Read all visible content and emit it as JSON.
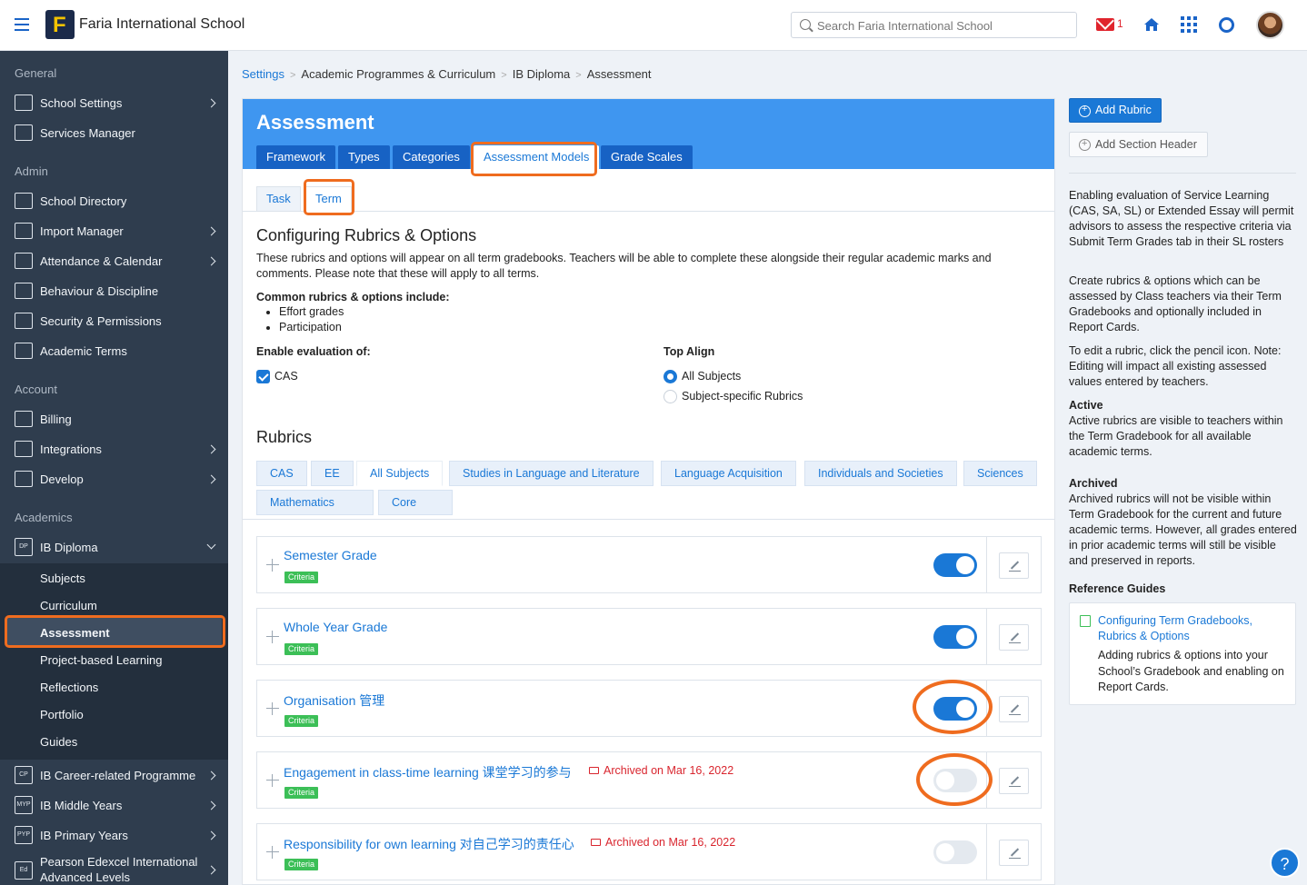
{
  "header": {
    "school_name": "Faria International School",
    "search_placeholder": "Search Faria International School",
    "mail_count": "1"
  },
  "sidebar": {
    "sections": {
      "general": "General",
      "admin": "Admin",
      "account": "Account",
      "academics": "Academics"
    },
    "items": {
      "school_settings": "School Settings",
      "services_manager": "Services Manager",
      "school_directory": "School Directory",
      "import_manager": "Import Manager",
      "attendance": "Attendance & Calendar",
      "behaviour": "Behaviour & Discipline",
      "security": "Security & Permissions",
      "academic_terms": "Academic Terms",
      "billing": "Billing",
      "integrations": "Integrations",
      "develop": "Develop",
      "ib_diploma": "IB Diploma",
      "ib_career": "IB Career-related Programme",
      "ib_middle": "IB Middle Years",
      "ib_primary": "IB Primary Years",
      "pearson_1": "Pearson Edexcel International",
      "pearson_2": "Advanced Levels"
    },
    "icon_texts": {
      "dp": "DP",
      "cp": "CP",
      "myp": "MYP",
      "pyp": "PYP",
      "ed": "Ed"
    },
    "sub_items": [
      "Subjects",
      "Curriculum",
      "Assessment",
      "Project-based Learning",
      "Reflections",
      "Portfolio",
      "Guides"
    ]
  },
  "breadcrumb": [
    "Settings",
    "Academic Programmes & Curriculum",
    "IB Diploma",
    "Assessment"
  ],
  "main": {
    "title": "Assessment",
    "tabs": [
      "Framework",
      "Types",
      "Categories",
      "Assessment Models",
      "Grade Scales"
    ],
    "subtabs": [
      "Task",
      "Term"
    ],
    "config_title": "Configuring Rubrics & Options",
    "config_desc": "These rubrics and options will appear on all term gradebooks. Teachers will be able to complete these alongside their regular academic marks and comments. Please note that these will apply to all terms.",
    "common_label": "Common rubrics & options include:",
    "common_items": [
      "Effort grades",
      "Participation"
    ],
    "enable_label": "Enable evaluation of:",
    "enable_cas": "CAS",
    "top_align_label": "Top Align",
    "top_align_options": [
      "All Subjects",
      "Subject-specific Rubrics"
    ],
    "rubrics_title": "Rubrics",
    "filters": [
      "CAS",
      "EE",
      "All Subjects",
      "Studies in Language and Literature",
      "Language Acquisition",
      "Individuals and Societies",
      "Sciences",
      "Mathematics",
      "Core"
    ],
    "rubrics": [
      {
        "title": "Semester Grade",
        "badge": "Criteria",
        "archived": "",
        "active": true
      },
      {
        "title": "Whole Year Grade",
        "badge": "Criteria",
        "archived": "",
        "active": true
      },
      {
        "title": "Organisation 管理",
        "badge": "Criteria",
        "archived": "",
        "active": true
      },
      {
        "title": "Engagement in class-time learning 课堂学习的参与",
        "badge": "Criteria",
        "archived": "Archived on Mar 16, 2022",
        "active": false
      },
      {
        "title": "Responsibility for own learning 对自己学习的责任心",
        "badge": "Criteria",
        "archived": "Archived on Mar 16, 2022",
        "active": false
      }
    ]
  },
  "right": {
    "add_rubric": "Add Rubric",
    "add_section_header": "Add Section Header",
    "p1": "Enabling evaluation of Service Learning (CAS, SA, SL) or Extended Essay will permit advisors to assess the respective criteria via Submit Term Grades tab in their SL rosters",
    "p2": "Create rubrics & options which can be assessed by Class teachers via their Term Gradebooks and optionally included in Report Cards.",
    "p3": "To edit a rubric, click the pencil icon. Note: Editing will impact all existing assessed values entered by teachers.",
    "active_head": "Active",
    "active_text": "Active rubrics are visible to teachers within the Term Gradebook for all available academic terms.",
    "archived_head": "Archived",
    "archived_text": "Archived rubrics will not be visible within Term Gradebook for the current and future academic terms. However, all grades entered in prior academic terms will still be visible and preserved in reports.",
    "ref_head": "Reference Guides",
    "guide_link": "Configuring Term Gradebooks, Rubrics & Options",
    "guide_desc": "Adding rubrics & options into your School’s Gradebook and enabling on Report Cards."
  },
  "help_fab": "?",
  "colors": {
    "brand_blue": "#1a78d6",
    "header_band": "#3f96f0",
    "sidebar_bg": "#2f3d4e",
    "highlight_orange": "#ef6c1f",
    "criteria_green": "#3cbf57",
    "archived_red": "#d9252e"
  }
}
